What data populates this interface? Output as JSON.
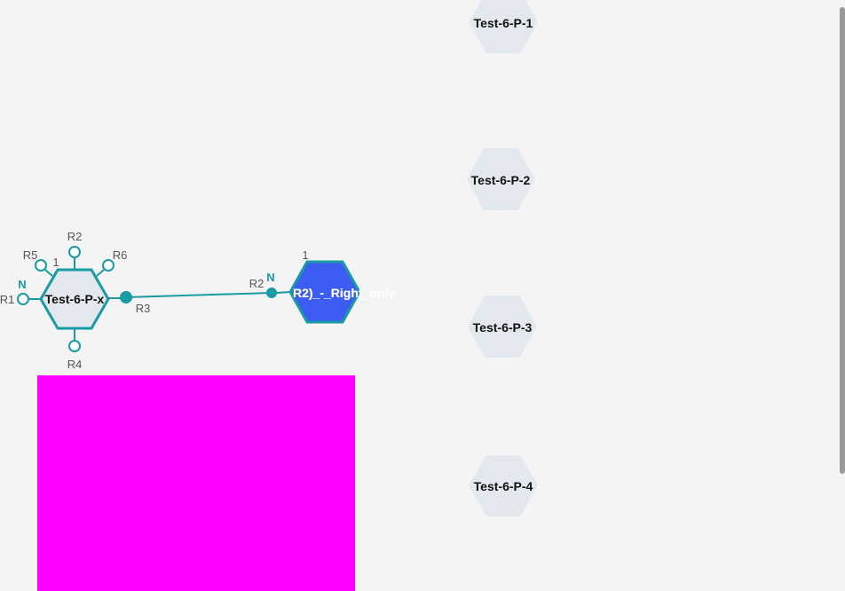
{
  "colors": {
    "background": "#f4f4f4",
    "teal": "#1a9aa3",
    "monomer_fill": "#e3e7ee",
    "selected_fill": "#3c5cf2",
    "magenta": "#ff00ff",
    "palette_fill": "#e3e7ee"
  },
  "monomer_a": {
    "label": "Test-6-P-x",
    "index": "1",
    "attachment_points": {
      "r1": "R1",
      "r2": "R2",
      "r3": "R3",
      "r4": "R4",
      "r5": "R5",
      "r6": "R6"
    },
    "terminal": "N"
  },
  "monomer_b": {
    "label": "R2)_-_Right_only",
    "index": "1",
    "attachment_point": "R2",
    "terminal": "N"
  },
  "palette": {
    "items": [
      {
        "label": "Test-6-P-1"
      },
      {
        "label": "Test-6-P-2"
      },
      {
        "label": "Test-6-P-3"
      },
      {
        "label": "Test-6-P-4"
      }
    ]
  }
}
